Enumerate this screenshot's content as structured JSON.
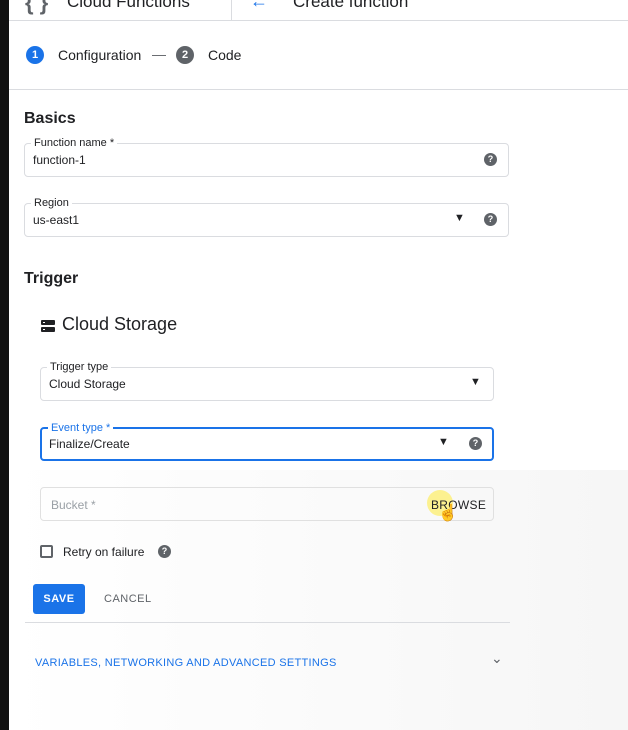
{
  "header": {
    "product_name": "Cloud Functions",
    "page_title": "Create function"
  },
  "stepper": {
    "steps": [
      {
        "number": "1",
        "label": "Configuration",
        "active": true
      },
      {
        "number": "2",
        "label": "Code",
        "active": false
      }
    ],
    "separator": "—"
  },
  "basics": {
    "title": "Basics",
    "function_name": {
      "label": "Function name *",
      "value": "function-1"
    },
    "region": {
      "label": "Region",
      "value": "us-east1"
    }
  },
  "trigger": {
    "title": "Trigger",
    "provider_title": "Cloud Storage",
    "trigger_type": {
      "label": "Trigger type",
      "value": "Cloud Storage"
    },
    "event_type": {
      "label": "Event type *",
      "value": "Finalize/Create"
    },
    "bucket": {
      "placeholder": "Bucket *",
      "browse_label": "BROWSE"
    },
    "retry": {
      "label": "Retry on failure",
      "checked": false
    },
    "save_label": "SAVE",
    "cancel_label": "CANCEL"
  },
  "advanced": {
    "label": "VARIABLES, NETWORKING AND ADVANCED SETTINGS"
  },
  "icons": {
    "help": "help-circle-icon",
    "dropdown": "caret-down-icon",
    "expand": "chevron-down-icon",
    "storage": "storage-icon",
    "cursor": "hand-pointer-icon"
  },
  "colors": {
    "accent": "#1a73e8",
    "step_inactive": "#5f6368",
    "highlight": "#ffeb3b"
  }
}
